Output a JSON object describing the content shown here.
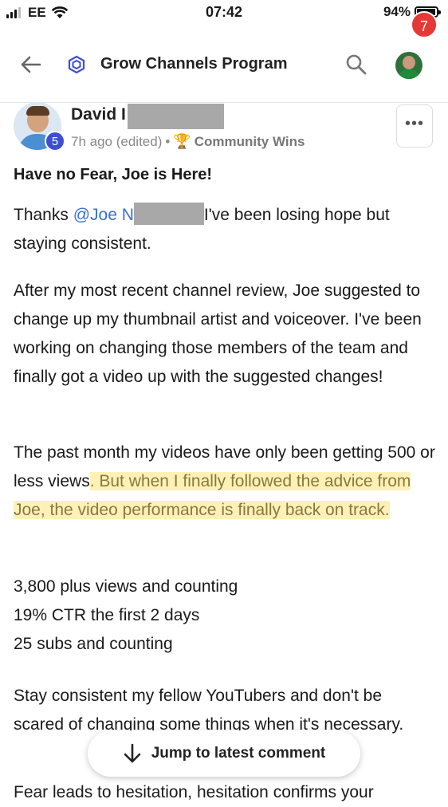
{
  "status_bar": {
    "carrier": "EE",
    "time": "07:42",
    "battery": "94%",
    "battery_level": 0.94
  },
  "header": {
    "title": "Grow Channels Program",
    "notification_count": "7",
    "icons": [
      "back-arrow-icon",
      "hexagon-logo-icon",
      "search-icon"
    ]
  },
  "post": {
    "author": "David I",
    "level": "5",
    "time": "7h ago (edited)",
    "separator": "•",
    "category": "Community Wins",
    "category_icon": "trophy-icon",
    "more": "•••",
    "title": "Have no Fear, Joe is Here!",
    "p1": {
      "a": "Thanks ",
      "mention": "@Joe N",
      "b": "I've been losing hope but staying consistent."
    },
    "p2": "After my most recent channel review, Joe suggested to change up my thumbnail artist and voiceover. I've been working on changing those members of the team and finally got a video up with the suggested changes!",
    "p3": {
      "plain": "The past month my videos have only been getting 500 or less views",
      "highlight": ". But when I finally followed the advice from Joe, the video performance is finally back on track."
    },
    "stats": [
      "3,800 plus views and counting",
      "19% CTR the first 2 days",
      "25 subs and counting"
    ],
    "p5": "Stay consistent my fellow YouTubers and don't be scared of changing some things when it's necessary.",
    "p6": "Fear leads to hesitation, hesitation confirms your"
  },
  "jump_button": {
    "label": "Jump to latest comment"
  },
  "colors": {
    "accent": "#3b6fd4",
    "badge": "#e53935",
    "level_badge": "#3d4fd1",
    "highlight": "#fdf1b8"
  }
}
